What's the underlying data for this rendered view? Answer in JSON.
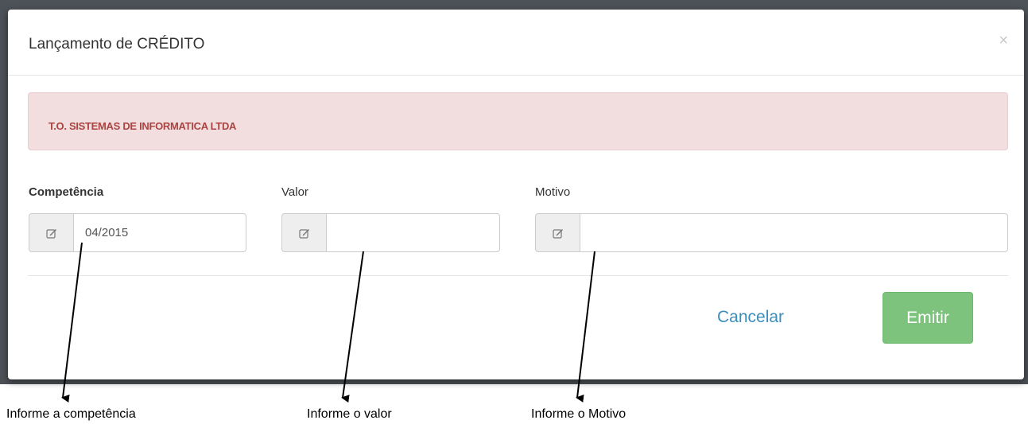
{
  "modal": {
    "title": "Lançamento de CRÉDITO",
    "close_symbol": "×"
  },
  "alert": {
    "company_name": "T.O. SISTEMAS DE INFORMATICA LTDA"
  },
  "fields": {
    "competencia": {
      "label": "Competência",
      "value": "04/2015",
      "icon": "edit-icon"
    },
    "valor": {
      "label": "Valor",
      "value": "",
      "icon": "edit-icon"
    },
    "motivo": {
      "label": "Motivo",
      "value": "",
      "icon": "edit-icon"
    }
  },
  "footer": {
    "cancel_label": "Cancelar",
    "emit_label": "Emitir"
  },
  "annotations": {
    "competencia": "Informe a competência",
    "valor": "Informe o valor",
    "motivo": "Informe o Motivo"
  },
  "colors": {
    "alert_bg": "#f2dede",
    "alert_text": "#a94442",
    "link": "#3c8dbc",
    "emit_button": "#7dc27d"
  }
}
